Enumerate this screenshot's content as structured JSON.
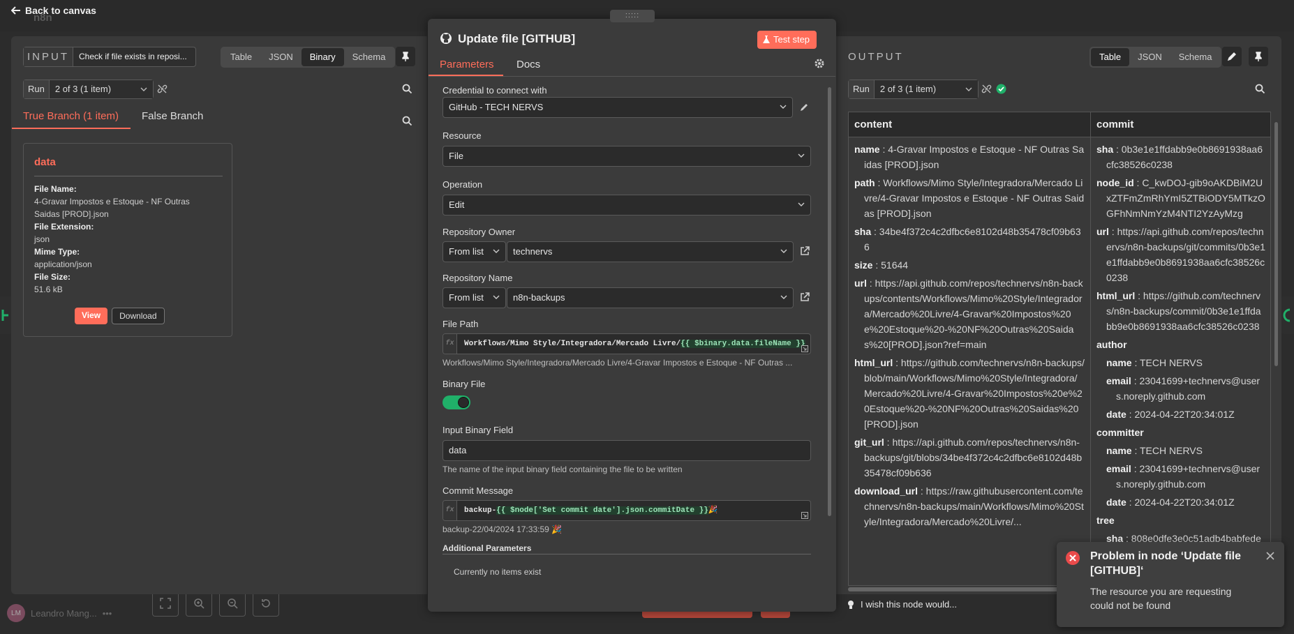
{
  "topbar": {
    "back_label": "Back to canvas",
    "app_name": "n8n"
  },
  "input": {
    "title": "INPUT",
    "node_select_value": "Check if file exists in reposi...",
    "view_tabs": [
      "Table",
      "JSON",
      "Binary",
      "Schema"
    ],
    "active_view": "Binary",
    "run_label": "Run",
    "run_value": "2 of 3 (1 item)",
    "branches": [
      "True Branch (1 item)",
      "False Branch"
    ],
    "card": {
      "title": "data",
      "file_name_label": "File Name:",
      "file_name": "4-Gravar Impostos e Estoque - NF Outras Saidas [PROD].json",
      "file_ext_label": "File Extension:",
      "file_ext": "json",
      "mime_label": "Mime Type:",
      "mime": "application/json",
      "size_label": "File Size:",
      "size": "51.6 kB",
      "view_label": "View",
      "download_label": "Download"
    }
  },
  "modal": {
    "title": "Update file [GITHUB]",
    "test_step_label": "Test step",
    "tabs": [
      "Parameters",
      "Docs"
    ],
    "active_tab": "Parameters",
    "credential_label": "Credential to connect with",
    "credential_value": "GitHub - TECH NERVS",
    "resource_label": "Resource",
    "resource_value": "File",
    "operation_label": "Operation",
    "operation_value": "Edit",
    "owner_label": "Repository Owner",
    "owner_mode": "From list",
    "owner_value": "technervs",
    "repo_label": "Repository Name",
    "repo_mode": "From list",
    "repo_value": "n8n-backups",
    "filepath_label": "File Path",
    "filepath_static": "Workflows/Mimo Style/Integradora/Mercado Livre/",
    "filepath_expr": "{{ $binary.data.fileName }}",
    "filepath_resolved": "Workflows/Mimo Style/Integradora/Mercado Livre/4-Gravar Impostos e Estoque - NF Outras ...",
    "binary_label": "Binary File",
    "binary_on": true,
    "input_binary_label": "Input Binary Field",
    "input_binary_value": "data",
    "input_binary_hint": "The name of the input binary field containing the file to be written",
    "commit_label": "Commit Message",
    "commit_static": "backup-",
    "commit_expr": "{{ $node['Set commit date'].json.commitDate }}",
    "commit_emoji": "🎉",
    "commit_resolved": "backup-22/04/2024 17:33:59 🎉",
    "additional_label": "Additional Parameters",
    "no_items": "Currently no items exist",
    "feedback": "I wish this node would..."
  },
  "output": {
    "title": "OUTPUT",
    "view_tabs": [
      "Table",
      "JSON",
      "Schema"
    ],
    "active_view": "Table",
    "run_label": "Run",
    "run_value": "2 of 3 (1 item)",
    "columns": [
      "content",
      "commit"
    ],
    "content": {
      "name_k": "name",
      "name_v": "4-Gravar Impostos e Estoque - NF Outras Saidas [PROD].json",
      "path_k": "path",
      "path_v": "Workflows/Mimo Style/Integradora/Mercado Livre/4-Gravar Impostos e Estoque - NF Outras Saidas [PROD].json",
      "sha_k": "sha",
      "sha_v": "34be4f372c4c2dfbc6e8102d48b35478cf09b636",
      "size_k": "size",
      "size_v": "51644",
      "url_k": "url",
      "url_v": "https://api.github.com/repos/technervs/n8n-backups/contents/Workflows/Mimo%20Style/Integradora/Mercado%20Livre/4-Gravar%20Impostos%20e%20Estoque%20-%20NF%20Outras%20Saidas%20[PROD].json?ref=main",
      "html_url_k": "html_url",
      "html_url_v": "https://github.com/technervs/n8n-backups/blob/main/Workflows/Mimo%20Style/Integradora/Mercado%20Livre/4-Gravar%20Impostos%20e%20Estoque%20-%20NF%20Outras%20Saidas%20[PROD].json",
      "git_url_k": "git_url",
      "git_url_v": "https://api.github.com/repos/technervs/n8n-backups/git/blobs/34be4f372c4c2dfbc6e8102d48b35478cf09b636",
      "download_url_k": "download_url",
      "download_url_v": "https://raw.githubusercontent.com/technervs/n8n-backups/main/Workflows/Mimo%20Style/Integradora/Mercado%20Livre/..."
    },
    "commit": {
      "sha_k": "sha",
      "sha_v": "0b3e1e1ffdabb9e0b8691938aa6cfc38526c0238",
      "node_id_k": "node_id",
      "node_id_v": "C_kwDOJ-gib9oAKDBiM2UxZTFmZmRhYmI5ZTBiODY5MTkzOGFhNmNmYzM4NTI2YzAyMzg",
      "url_k": "url",
      "url_v": "https://api.github.com/repos/technervs/n8n-backups/git/commits/0b3e1e1ffdabb9e0b8691938aa6cfc38526c0238",
      "html_url_k": "html_url",
      "html_url_v": "https://github.com/technervs/n8n-backups/commit/0b3e1e1ffdabb9e0b8691938aa6cfc38526c0238",
      "author_k": "author",
      "author_name_k": "name",
      "author_name_v": "TECH NERVS",
      "author_email_k": "email",
      "author_email_v": "23041699+technervs@users.noreply.github.com",
      "author_date_k": "date",
      "author_date_v": "2024-04-22T20:34:01Z",
      "committer_k": "committer",
      "committer_name_k": "name",
      "committer_name_v": "TECH NERVS",
      "committer_email_k": "email",
      "committer_email_v": "23041699+technervs@users.noreply.github.com",
      "committer_date_k": "date",
      "committer_date_v": "2024-04-22T20:34:01Z",
      "tree_k": "tree",
      "tree_sha_k": "sha",
      "tree_sha_v": "808e0dfe3e0c51adb4babfede2"
    }
  },
  "toast": {
    "title": "Problem in node ‘Update file [GITHUB]‘",
    "message": "The resource you are requesting could not be found"
  },
  "user": {
    "initials": "LM",
    "name": "Leandro Mang..."
  },
  "colors": {
    "accent": "#ff6d5a",
    "success": "#20b069",
    "error": "#ea4b4b"
  }
}
